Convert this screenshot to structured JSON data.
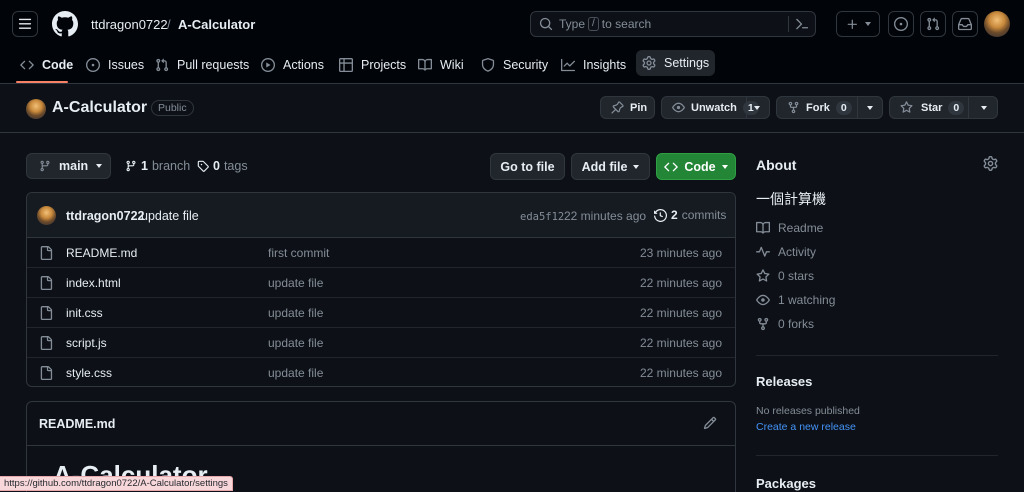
{
  "header": {
    "owner": "ttdragon0722",
    "separator": "/",
    "repo": "A-Calculator",
    "search_prefix": "Type",
    "search_key": "/",
    "search_suffix": "to search"
  },
  "nav": [
    {
      "label": "Code",
      "icon": "code-icon"
    },
    {
      "label": "Issues",
      "icon": "issue-icon"
    },
    {
      "label": "Pull requests",
      "icon": "pull-request-icon"
    },
    {
      "label": "Actions",
      "icon": "play-icon"
    },
    {
      "label": "Projects",
      "icon": "table-icon"
    },
    {
      "label": "Wiki",
      "icon": "book-icon"
    },
    {
      "label": "Security",
      "icon": "shield-icon"
    },
    {
      "label": "Insights",
      "icon": "graph-icon"
    },
    {
      "label": "Settings",
      "icon": "gear-icon"
    }
  ],
  "repo": {
    "name": "A-Calculator",
    "visibility": "Public",
    "pin_label": "Pin",
    "watch_label": "Unwatch",
    "watch_count": "1",
    "fork_label": "Fork",
    "fork_count": "0",
    "star_label": "Star",
    "star_count": "0"
  },
  "branch": {
    "current": "main",
    "branch_count": "1",
    "branch_label": "branch",
    "tag_count": "0",
    "tag_label": "tags",
    "goto_label": "Go to file",
    "add_label": "Add file",
    "code_label": "Code"
  },
  "commit": {
    "author": "ttdragon0722",
    "message": "update file",
    "sha": "eda5f12",
    "time": "22 minutes ago",
    "count": "2",
    "count_label": "commits"
  },
  "files": [
    {
      "name": "README.md",
      "commit": "first commit",
      "time": "23 minutes ago"
    },
    {
      "name": "index.html",
      "commit": "update file",
      "time": "22 minutes ago"
    },
    {
      "name": "init.css",
      "commit": "update file",
      "time": "22 minutes ago"
    },
    {
      "name": "script.js",
      "commit": "update file",
      "time": "22 minutes ago"
    },
    {
      "name": "style.css",
      "commit": "update file",
      "time": "22 minutes ago"
    }
  ],
  "readme": {
    "filename": "README.md",
    "heading": "A-Calculator"
  },
  "about": {
    "title": "About",
    "description": "一個計算機",
    "items": [
      {
        "label": "Readme",
        "icon": "book-icon"
      },
      {
        "label": "Activity",
        "icon": "pulse-icon"
      },
      {
        "label": "0 stars",
        "icon": "star-icon"
      },
      {
        "label": "1 watching",
        "icon": "eye-icon"
      },
      {
        "label": "0 forks",
        "icon": "fork-icon"
      }
    ]
  },
  "releases": {
    "title": "Releases",
    "none_text": "No releases published",
    "create_link": "Create a new release"
  },
  "packages": {
    "title": "Packages"
  },
  "status_url": "https://github.com/ttdragon0722/A-Calculator/settings"
}
